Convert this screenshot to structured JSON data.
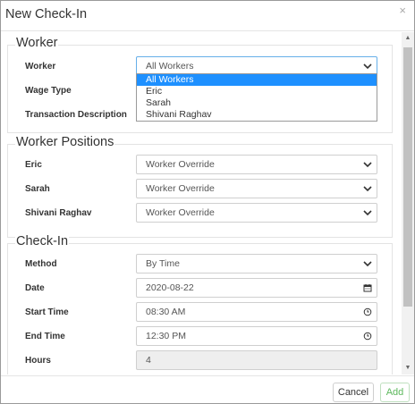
{
  "dialog": {
    "title": "New Check-In",
    "close_glyph": "×"
  },
  "worker_section": {
    "legend": "Worker",
    "worker_label": "Worker",
    "worker_value": "All Workers",
    "wage_type_label": "Wage Type",
    "transaction_description_label": "Transaction Description",
    "dropdown_options": [
      "All Workers",
      "Eric",
      "Sarah",
      "Shivani Raghav"
    ],
    "dropdown_selected_index": 0
  },
  "worker_positions_section": {
    "legend": "Worker Positions",
    "rows": [
      {
        "label": "Eric",
        "value": "Worker Override"
      },
      {
        "label": "Sarah",
        "value": "Worker Override"
      },
      {
        "label": "Shivani Raghav",
        "value": "Worker Override"
      }
    ]
  },
  "checkin_section": {
    "legend": "Check-In",
    "method_label": "Method",
    "method_value": "By Time",
    "date_label": "Date",
    "date_value": "2020-08-22",
    "start_time_label": "Start Time",
    "start_time_value": "08:30 AM",
    "end_time_label": "End Time",
    "end_time_value": "12:30 PM",
    "hours_label": "Hours",
    "hours_value": "4"
  },
  "footer": {
    "cancel_label": "Cancel",
    "add_label": "Add"
  },
  "colors": {
    "accent_selected": "#1e90ff",
    "add_button_text": "#5cb85c",
    "readonly_background": "#eeeeee"
  },
  "icons": {
    "select_arrow": "chevron-down-icon",
    "date_picker": "calendar-icon",
    "time_picker": "clock-icon",
    "close": "close-icon"
  }
}
